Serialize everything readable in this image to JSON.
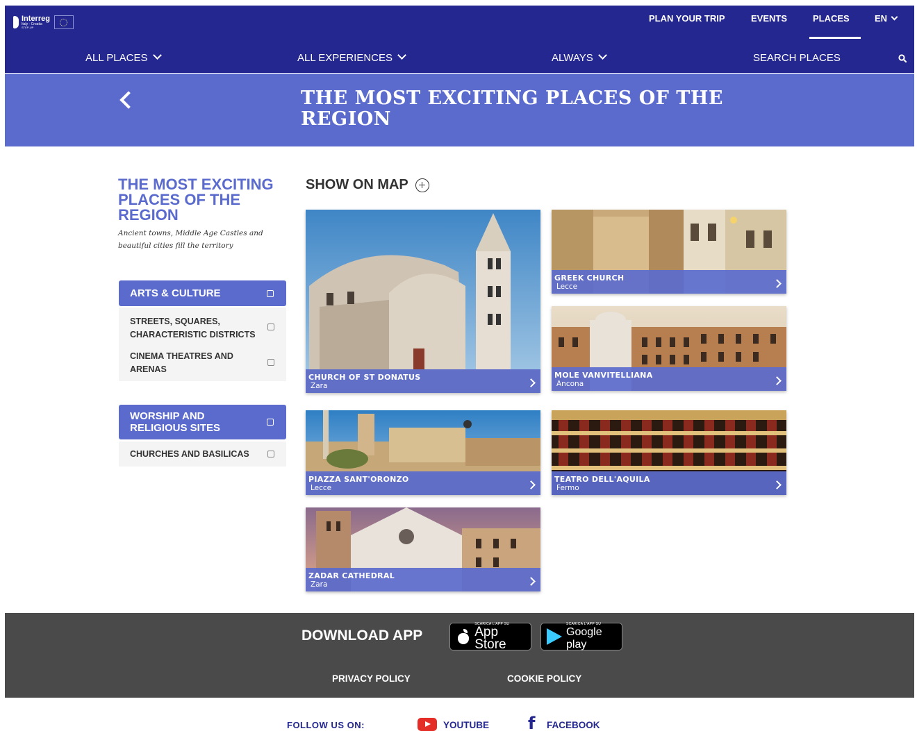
{
  "header": {
    "logo": {
      "brand": "Interreg",
      "program": "Italy - Croatia",
      "project": "STEP-UP"
    },
    "nav": [
      {
        "label": "PLAN YOUR TRIP"
      },
      {
        "label": "EVENTS"
      },
      {
        "label": "PLACES",
        "active": true
      },
      {
        "label": "EN"
      }
    ],
    "filters": [
      {
        "label": "ALL PLACES"
      },
      {
        "label": "ALL EXPERIENCES"
      },
      {
        "label": "ALWAYS"
      }
    ],
    "search": {
      "label": "SEARCH PLACES",
      "icon": "search-icon"
    }
  },
  "banner": {
    "title": "THE MOST EXCITING PLACES OF THE REGION",
    "back_icon": "chevron-left-icon"
  },
  "sidebar": {
    "title": "THE MOST EXCITING PLACES OF THE REGION",
    "subtitle": "Ancient towns, Middle Age Castles and beautiful cities fill the territory",
    "groups": [
      {
        "label": "ARTS & CULTURE",
        "items": [
          {
            "label": "STREETS, SQUARES, CHARACTERISTIC DISTRICTS"
          },
          {
            "label": "CINEMA THEATRES AND ARENAS"
          }
        ]
      },
      {
        "label": "WORSHIP AND RELIGIOUS SITES",
        "items": [
          {
            "label": "CHURCHES AND BASILICAS"
          }
        ]
      }
    ]
  },
  "main": {
    "show_map": "SHOW ON MAP",
    "cards": [
      {
        "name": "CHURCH OF ST DONATUS",
        "city": "Zara"
      },
      {
        "name": "GREEK CHURCH",
        "city": "Lecce"
      },
      {
        "name": "MOLE VANVITELLIANA",
        "city": "Ancona"
      },
      {
        "name": "PIAZZA SANT'ORONZO",
        "city": "Lecce"
      },
      {
        "name": "TEATRO DELL'AQUILA",
        "city": "Fermo"
      },
      {
        "name": "ZADAR CATHEDRAL",
        "city": "Zara"
      }
    ]
  },
  "footer": {
    "download_label": "DOWNLOAD APP",
    "app_store": {
      "small": "SCARICA L'APP SU",
      "big": "App Store"
    },
    "google_play": {
      "small": "SCARICA L'APP SU",
      "big": "Google play"
    },
    "links": [
      {
        "label": "PRIVACY POLICY"
      },
      {
        "label": "COOKIE POLICY"
      }
    ],
    "follow_label": "FOLLOW US ON:",
    "social": [
      {
        "label": "YOUTUBE"
      },
      {
        "label": "FACEBOOK"
      }
    ]
  },
  "colors": {
    "navy": "#24278f",
    "accent": "#5b6bcd",
    "footer": "#4a4a4a"
  }
}
